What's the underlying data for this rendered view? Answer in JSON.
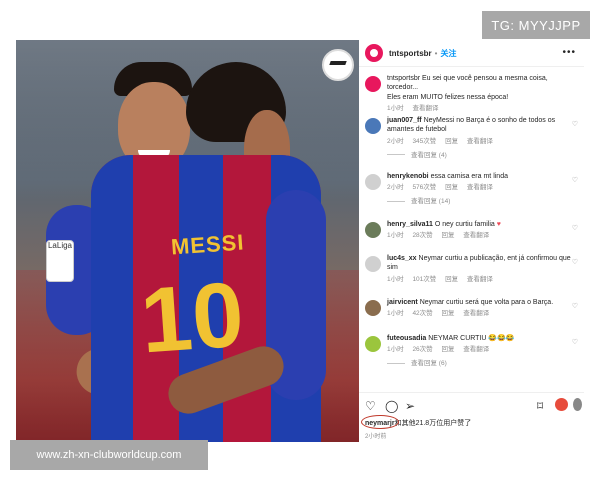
{
  "badge": {
    "tg": "TG: MYYJJPP"
  },
  "post": {
    "username": "tntsportsbr",
    "follow": "关注",
    "caption_line1": "tntsportsbr Eu sei que você pensou a mesma coisa, torcedor...",
    "caption_line2": "Eles eram MUITO felizes nessa época!",
    "caption_meta": [
      "1小时",
      "查看翻译"
    ],
    "jersey_name": "MESSI",
    "jersey_number": "10",
    "laliga": "LaLiga"
  },
  "comments": [
    {
      "user": "juan007_ff",
      "text": " NeyMessi no Barça é o sonho de todos os amantes de futebol",
      "meta": [
        "2小时",
        "345次赞",
        "回复",
        "查看翻译"
      ],
      "replies": "查看回复 (4)",
      "avatar_color": "#4a78b8"
    },
    {
      "user": "henrykenobi",
      "text": " essa camisa era mt linda",
      "meta": [
        "2小时",
        "576次赞",
        "回复",
        "查看翻译"
      ],
      "replies": "查看回复 (14)",
      "avatar_color": "#d0d0d0"
    },
    {
      "user": "henry_silva11",
      "text": " O ney curtiu familia",
      "meta": [
        "1小时",
        "28次赞",
        "回复",
        "查看翻译"
      ],
      "replies": "",
      "avatar_color": "#6b7c5a"
    },
    {
      "user": "luc4s_xx",
      "text": " Neymar curtiu a publicação, ent já confirmou que sim",
      "meta": [
        "1小时",
        "101次赞",
        "回复",
        "查看翻译"
      ],
      "replies": "",
      "avatar_color": "#d0d0d0"
    },
    {
      "user": "jairvicent",
      "text": " Neymar curtiu será que volta para o Barça.",
      "meta": [
        "1小时",
        "42次赞",
        "回复",
        "查看翻译"
      ],
      "replies": "",
      "avatar_color": "#8a6d4e"
    },
    {
      "user": "futeousadia",
      "text": " NEYMAR CURTIU 😂😂😂",
      "meta": [
        "1小时",
        "26次赞",
        "回复",
        "查看翻译"
      ],
      "replies": "查看回复 (6)",
      "avatar_color": "#9bc53d"
    }
  ],
  "likes": {
    "user": "neymarjr",
    "rest": "和其他21.8万位用户赞了"
  },
  "time": "2小时前",
  "footer": {
    "site": "www.zh-xn-clubworldcup.com"
  },
  "colors": {
    "accent": "#0095f6",
    "like_red": "#ed4956",
    "badge_bg": "#a8a8a8"
  }
}
